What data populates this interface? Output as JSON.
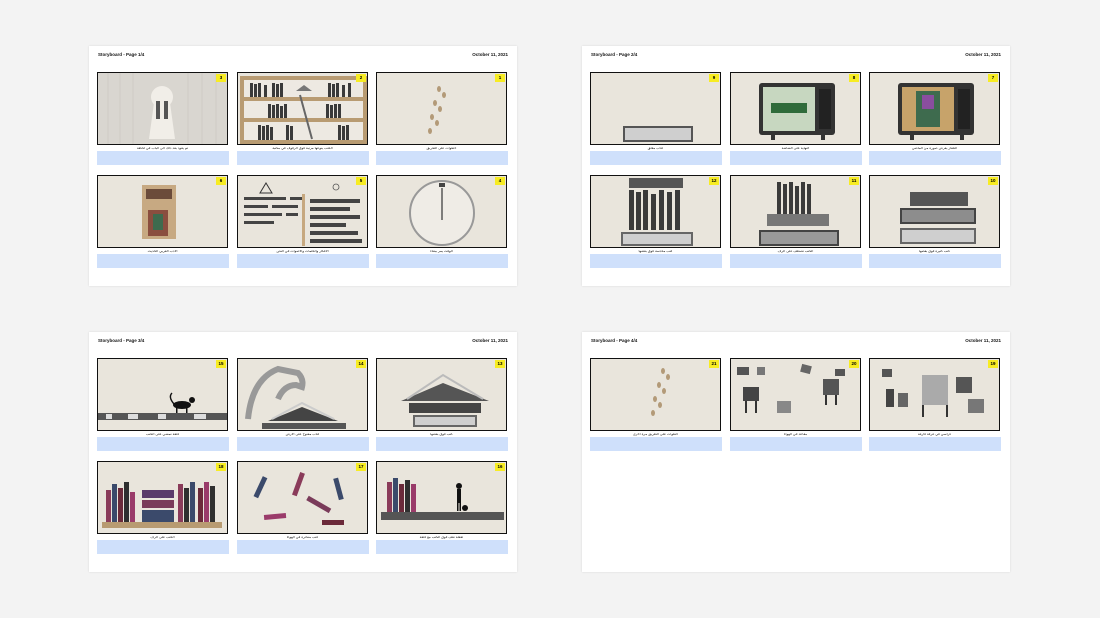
{
  "pages": [
    {
      "title": "Storyboard - Page 1/4",
      "date": "October 11, 2021",
      "frames": [
        {
          "num": "3",
          "caption": "ثم يعود بعد ذلك الى الباب في لحظة"
        },
        {
          "num": "2",
          "caption": "الكتب ينوعها مرتبة فوق الرفوف في مكتبة"
        },
        {
          "num": "1",
          "caption": "خطوات على الطريق"
        },
        {
          "num": "6",
          "caption": "الأدب العربي الحديث"
        },
        {
          "num": "5",
          "caption": "الأفكار والكلمات والأصوات في النص"
        },
        {
          "num": "4",
          "caption": "الوقت يمر ببطء"
        }
      ]
    },
    {
      "title": "Storyboard - Page 2/4",
      "date": "October 11, 2021",
      "frames": [
        {
          "num": "9",
          "caption": "كتاب مغلق"
        },
        {
          "num": "8",
          "caption": "النهاية على الشاشة"
        },
        {
          "num": "7",
          "caption": "التلفاز يعرض صورة من الماضي"
        },
        {
          "num": "12",
          "caption": "كتب مكدسة فوق بعضها"
        },
        {
          "num": "11",
          "caption": "الكتب تصطف على الرف"
        },
        {
          "num": "10",
          "caption": "كتب كثيرة فوق بعضها"
        }
      ]
    },
    {
      "title": "Storyboard - Page 3/4",
      "date": "October 11, 2021",
      "frames": [
        {
          "num": "15",
          "caption": "قطة تمشي على الكتب"
        },
        {
          "num": "14",
          "caption": "كتاب مفتوح على الأرض"
        },
        {
          "num": "13",
          "caption": "كتب فوق بعضها"
        },
        {
          "num": "18",
          "caption": "الكتب على الرف"
        },
        {
          "num": "17",
          "caption": "كتب متناثرة في الهواء"
        },
        {
          "num": "16",
          "caption": "طفلة تقف فوق الكتب مع قطة"
        }
      ]
    },
    {
      "title": "Storyboard - Page 4/4",
      "date": "October 11, 2021",
      "frames": [
        {
          "num": "21",
          "caption": "خطوات على الطريق مرة أخرى"
        },
        {
          "num": "20",
          "caption": "مقاعد في الهواء"
        },
        {
          "num": "19",
          "caption": "كراسي في غرفة فارغة"
        }
      ]
    }
  ]
}
